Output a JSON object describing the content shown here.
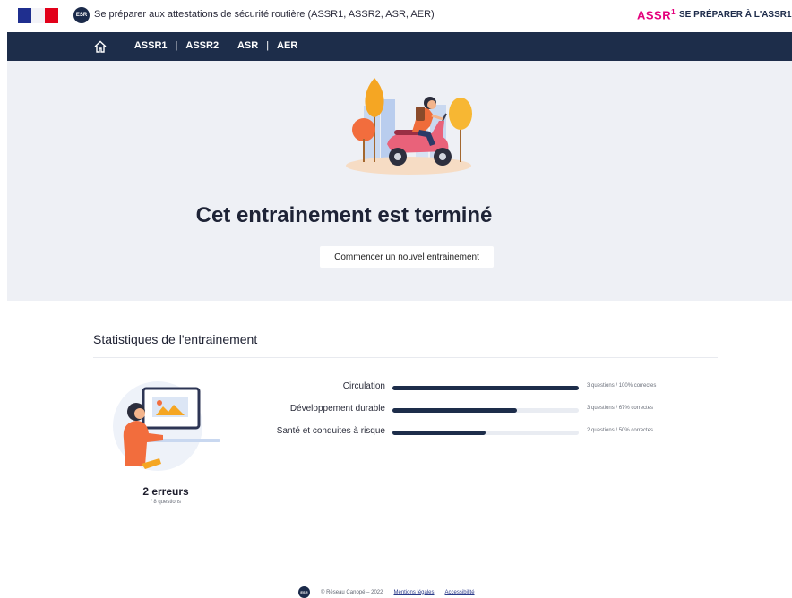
{
  "header": {
    "esr_logo_text": "ESR",
    "site_title": "Se préparer aux attestations de sécurité routière (ASSR1, ASSR2, ASR, AER)",
    "brand": "ASSR",
    "brand_sup": "1",
    "prepare_link": "SE PRÉPARER À L'ASSR1"
  },
  "nav": {
    "home_icon": "home-icon",
    "items": [
      "ASSR1",
      "ASSR2",
      "ASR",
      "AER"
    ],
    "separator": "|"
  },
  "hero": {
    "title": "Cet entrainement est terminé",
    "restart_button": "Commencer un nouvel entrainement"
  },
  "stats": {
    "title": "Statistiques de l'entrainement",
    "errors": "2 erreurs",
    "total": "/ 8 questions",
    "rows": [
      {
        "label": "Circulation",
        "value": "3 questions / 100% correctes",
        "percent": 100
      },
      {
        "label": "Développement durable",
        "value": "3 questions / 67% correctes",
        "percent": 67
      },
      {
        "label": "Santé et conduites à risque",
        "value": "2 questions / 50% correctes",
        "percent": 50
      }
    ]
  },
  "footer": {
    "logo_text": "ESR",
    "copyright": "© Réseau Canopé – 2022",
    "legal": "Mentions légales",
    "accessibility": "Accessibilité"
  },
  "colors": {
    "navy": "#1d2d4a",
    "brand_pink": "#e4007c",
    "hero_bg": "#eef0f5",
    "track": "#e9ecf2"
  }
}
